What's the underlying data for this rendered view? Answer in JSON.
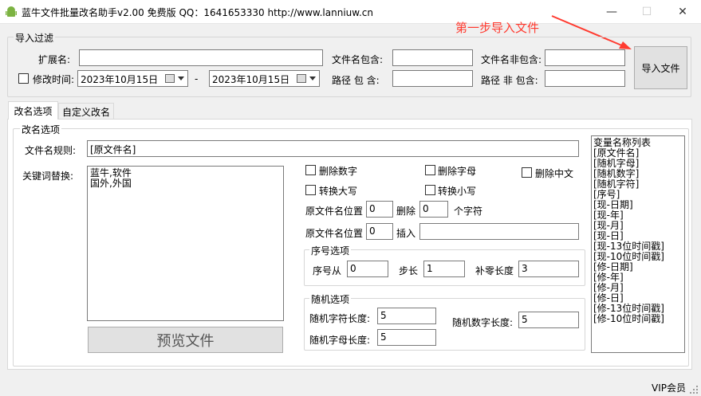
{
  "window": {
    "title": "蓝牛文件批量改名助手v2.00 免费版 QQ：1641653330  http://www.lanniuw.cn",
    "minimize": "—",
    "maximize": "☐",
    "close": "✕"
  },
  "annotation": "第一步导入文件",
  "import_filter": {
    "group_label": "导入过滤",
    "ext_label": "扩展名:",
    "ext_value": "",
    "modtime_label": "修改时间:",
    "date_from": "2023年10月15日",
    "date_sep": "-",
    "date_to": "2023年10月15日",
    "name_contains_label": "文件名包含:",
    "name_contains_value": "",
    "name_excludes_label": "文件名非包含:",
    "name_excludes_value": "",
    "path_contains_label": "路径 包 含:",
    "path_contains_value": "",
    "path_excludes_label": "路径 非 包含:",
    "path_excludes_value": "",
    "import_button": "导入文件"
  },
  "tabs": [
    {
      "label": "改名选项"
    },
    {
      "label": "自定义改名"
    }
  ],
  "rename": {
    "group_label": "改名选项",
    "rule_label": "文件名规则:",
    "rule_value": "[原文件名]",
    "keyword_label": "关键词替换:",
    "keyword_lines": [
      "蓝牛,软件",
      "国外,外国"
    ],
    "preview_button": "预览文件",
    "cb_delete_digits": "删除数字",
    "cb_delete_letters": "删除字母",
    "cb_delete_chinese": "删除中文",
    "cb_upper": "转换大写",
    "cb_lower": "转换小写",
    "del_pos_label": "原文件名位置",
    "del_pos_value": "0",
    "del_label": "删除",
    "del_count_value": "0",
    "del_unit": "个字符",
    "ins_pos_label": "原文件名位置",
    "ins_pos_value": "0",
    "ins_label": "插入",
    "ins_value": "",
    "seq_group_label": "序号选项",
    "seq_from_label": "序号从",
    "seq_from_value": "0",
    "seq_step_label": "步长",
    "seq_step_value": "1",
    "seq_pad_label": "补零长度",
    "seq_pad_value": "3",
    "rand_group_label": "随机选项",
    "rand_char_label": "随机字符长度:",
    "rand_char_value": "5",
    "rand_digit_label": "随机数字长度:",
    "rand_digit_value": "5",
    "rand_letter_label": "随机字母长度:",
    "rand_letter_value": "5"
  },
  "variables": {
    "items": [
      "变量名称列表",
      "[原文件名]",
      "[随机字母]",
      "[随机数字]",
      "[随机字符]",
      "[序号]",
      "[现-日期]",
      "[现-年]",
      "[现-月]",
      "[现-日]",
      "[现-13位时间戳]",
      "[现-10位时间戳]",
      "[修-日期]",
      "[修-年]",
      "[修-月]",
      "[修-日]",
      "[修-13位时间戳]",
      "[修-10位时间戳]"
    ]
  },
  "statusbar": {
    "vip_label": "VIP会员"
  },
  "colors": {
    "annotation": "#ff3b30",
    "window_bg": "#f0f0f0",
    "panel_bg": "#ffffff"
  }
}
